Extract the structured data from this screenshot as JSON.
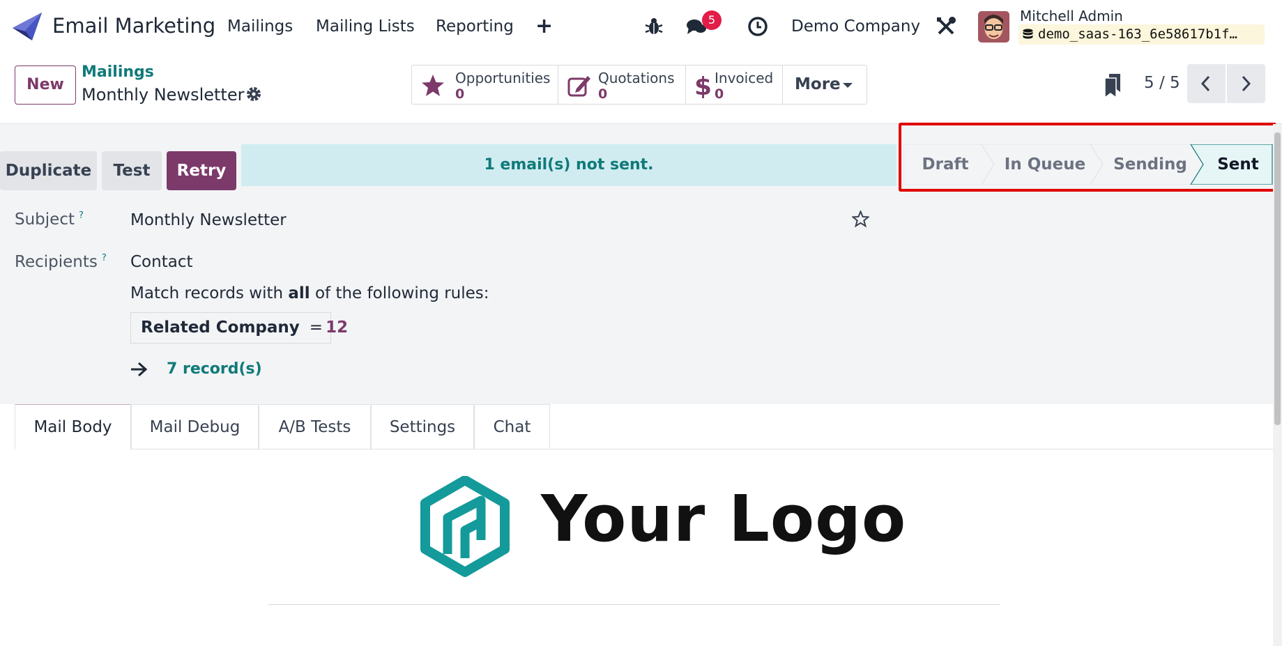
{
  "navbar": {
    "app_title": "Email Marketing",
    "menu": [
      "Mailings",
      "Mailing Lists",
      "Reporting"
    ],
    "plus": "+",
    "notifications_count": "5",
    "company": "Demo Company",
    "user_name": "Mitchell Admin",
    "database": "demo_saas-163_6e58617b1f…",
    "icons": [
      "bug-icon",
      "chat-icon",
      "clock-icon",
      "tools-icon",
      "database-icon"
    ]
  },
  "control_panel": {
    "new_label": "New",
    "breadcrumb_parent": "Mailings",
    "breadcrumb_current": "Monthly Newsletter",
    "stats": [
      {
        "label": "Opportunities",
        "value": "0",
        "icon": "star-icon"
      },
      {
        "label": "Quotations",
        "value": "0",
        "icon": "edit-icon"
      },
      {
        "label": "Invoiced",
        "value": "0",
        "icon": "dollar-icon"
      }
    ],
    "more_label": "More",
    "pager": "5 / 5"
  },
  "form": {
    "buttons": {
      "duplicate": "Duplicate",
      "test": "Test",
      "retry": "Retry"
    },
    "alert": "1  email(s) not sent.",
    "stages": [
      "Draft",
      "In Queue",
      "Sending",
      "Sent"
    ],
    "current_stage": "Sent",
    "subject_label": "Subject",
    "subject_value": "Monthly Newsletter",
    "help_mark": "?",
    "recipients_label": "Recipients",
    "recipients_value": "Contact",
    "rule_intro_before": "Match records with ",
    "rule_intro_bold": "all",
    "rule_intro_after": " of the following rules:",
    "rule": {
      "field": "Related Company",
      "operator": "=",
      "value": "12"
    },
    "records_link": "7 record(s)"
  },
  "tabs": [
    "Mail Body",
    "Mail Debug",
    "A/B Tests",
    "Settings",
    "Chat"
  ],
  "active_tab": "Mail Body",
  "mail_body": {
    "logo_text": "Your Logo"
  },
  "colors": {
    "brand": "#7c3a6a",
    "link": "#107a7a",
    "alert_bg": "#d1ecf1",
    "highlight": "#e00000"
  }
}
